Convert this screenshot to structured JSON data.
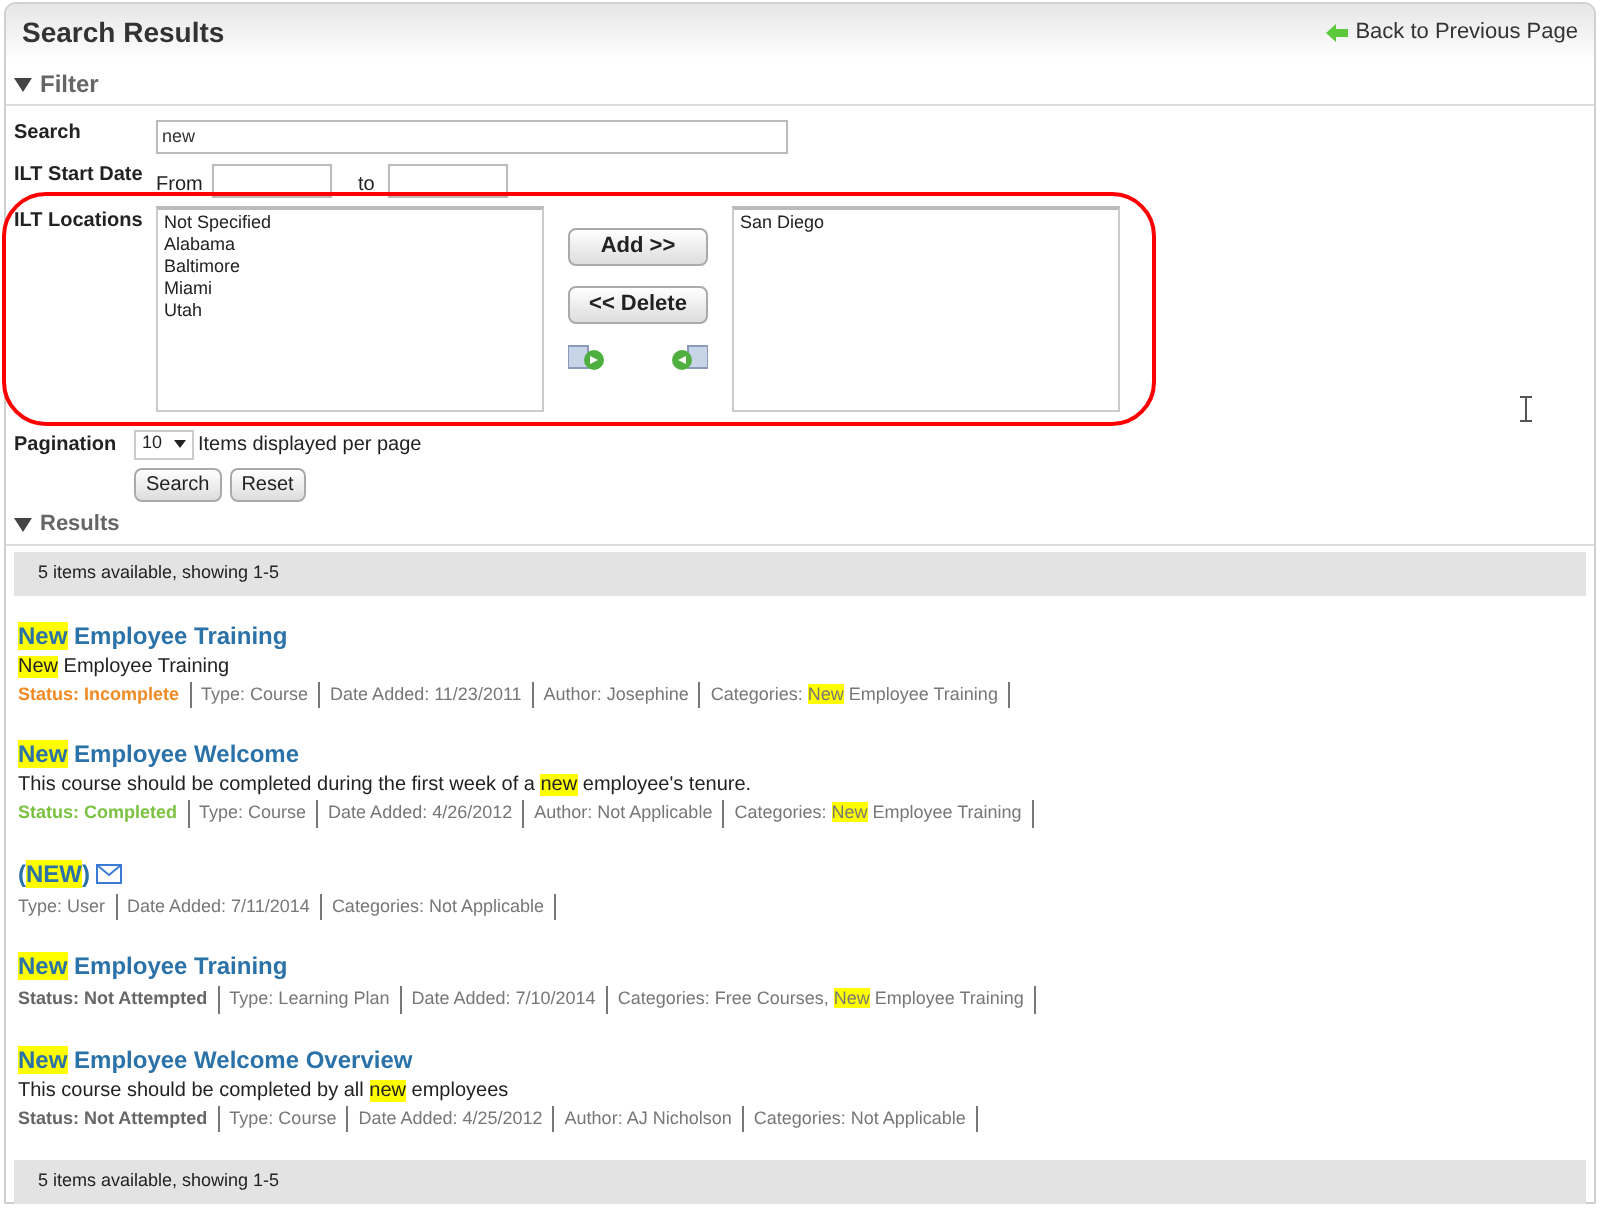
{
  "header": {
    "title": "Search Results",
    "back_link": "Back to Previous Page"
  },
  "filter": {
    "heading": "Filter",
    "expanded": true,
    "search": {
      "label": "Search",
      "value": "new"
    },
    "start_date": {
      "label": "ILT Start Date",
      "from_label": "From",
      "to_label": "to"
    },
    "locations": {
      "label": "ILT Locations",
      "available": [
        "Not Specified",
        "Alabama",
        "Baltimore",
        "Miami",
        "Utah"
      ],
      "chosen": [
        "San Diego"
      ],
      "add_button": "Add >>",
      "delete_button": "<< Delete"
    },
    "pagination": {
      "label": "Pagination",
      "value": "10",
      "suffix": "Items displayed per page"
    },
    "buttons": [
      "Search",
      "Reset"
    ]
  },
  "results": {
    "heading": "Results",
    "expanded": true,
    "summary_top": "5 items available, showing 1-5",
    "items": [
      {
        "title": [
          {
            "text": "New",
            "highlight": true
          },
          {
            "text": " Employee Training",
            "highlight": false
          }
        ],
        "mail": false,
        "description": [
          {
            "text": "New",
            "highlight": true
          },
          {
            "text": " Employee Training",
            "highlight": false
          }
        ],
        "status": {
          "text": "Status: Incomplete",
          "kind": "incomplete"
        },
        "meta": [
          [
            {
              "text": "Type: Course",
              "highlight": false
            }
          ],
          [
            {
              "text": "Date Added: 11/23/2011",
              "highlight": false
            }
          ],
          [
            {
              "text": "Author: Josephine",
              "highlight": false
            }
          ],
          [
            {
              "text": "Categories: ",
              "highlight": false
            },
            {
              "text": "New",
              "highlight": true
            },
            {
              "text": " Employee Training",
              "highlight": false
            }
          ]
        ]
      },
      {
        "title": [
          {
            "text": "New",
            "highlight": true
          },
          {
            "text": " Employee Welcome",
            "highlight": false
          }
        ],
        "mail": false,
        "description": [
          {
            "text": "This course should be completed during the first week of a ",
            "highlight": false
          },
          {
            "text": "new",
            "highlight": true
          },
          {
            "text": " employee's tenure.",
            "highlight": false
          }
        ],
        "status": {
          "text": "Status: Completed",
          "kind": "completed"
        },
        "meta": [
          [
            {
              "text": "Type: Course",
              "highlight": false
            }
          ],
          [
            {
              "text": "Date Added: 4/26/2012",
              "highlight": false
            }
          ],
          [
            {
              "text": "Author: Not Applicable",
              "highlight": false
            }
          ],
          [
            {
              "text": "Categories: ",
              "highlight": false
            },
            {
              "text": "New",
              "highlight": true
            },
            {
              "text": " Employee Training",
              "highlight": false
            }
          ]
        ]
      },
      {
        "title": [
          {
            "text": "(",
            "highlight": false
          },
          {
            "text": "NEW",
            "highlight": true
          },
          {
            "text": ")",
            "highlight": false
          }
        ],
        "mail": true,
        "meta": [
          [
            {
              "text": "Type: User",
              "highlight": false
            }
          ],
          [
            {
              "text": "Date Added: 7/11/2014",
              "highlight": false
            }
          ],
          [
            {
              "text": "Categories: Not Applicable",
              "highlight": false
            }
          ]
        ]
      },
      {
        "title": [
          {
            "text": "New",
            "highlight": true
          },
          {
            "text": " Employee Training",
            "highlight": false
          }
        ],
        "mail": false,
        "status": {
          "text": "Status: Not Attempted",
          "kind": "not_attempted"
        },
        "meta": [
          [
            {
              "text": "Type: Learning Plan",
              "highlight": false
            }
          ],
          [
            {
              "text": "Date Added: 7/10/2014",
              "highlight": false
            }
          ],
          [
            {
              "text": "Categories: Free Courses, ",
              "highlight": false
            },
            {
              "text": "New",
              "highlight": true
            },
            {
              "text": " Employee Training",
              "highlight": false
            }
          ]
        ]
      },
      {
        "title": [
          {
            "text": "New",
            "highlight": true
          },
          {
            "text": " Employee Welcome Overview",
            "highlight": false
          }
        ],
        "mail": false,
        "description": [
          {
            "text": "This course should be completed by all ",
            "highlight": false
          },
          {
            "text": "new",
            "highlight": true
          },
          {
            "text": " employees",
            "highlight": false
          }
        ],
        "status": {
          "text": "Status: Not Attempted",
          "kind": "not_attempted"
        },
        "meta": [
          [
            {
              "text": "Type: Course",
              "highlight": false
            }
          ],
          [
            {
              "text": "Date Added: 4/25/2012",
              "highlight": false
            }
          ],
          [
            {
              "text": "Author: AJ Nicholson",
              "highlight": false
            }
          ],
          [
            {
              "text": "Categories: Not Applicable",
              "highlight": false
            }
          ]
        ]
      }
    ],
    "summary_bottom": "5 items available, showing 1-5"
  }
}
